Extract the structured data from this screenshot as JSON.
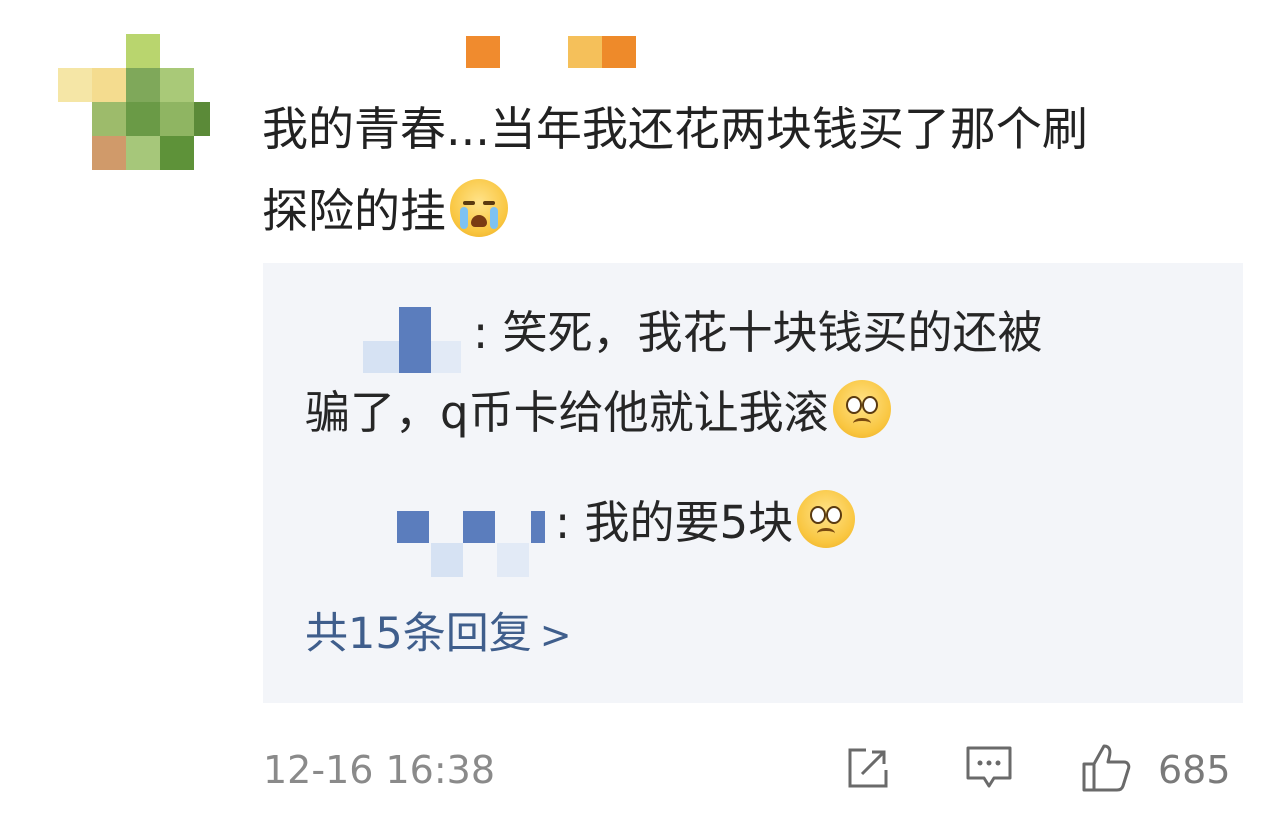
{
  "comment": {
    "line1": "我的青春...当年我还花两块钱买了那个刷",
    "line2": "探险的挂",
    "emoji": "loudly-crying-face-icon"
  },
  "replies": [
    {
      "text_line1": ": 笑死，我花十块钱买的还被",
      "text_line2": "骗了，q币卡给他就让我滚",
      "emoji": "pleading-face-icon"
    },
    {
      "text_line1": ": 我的要5块",
      "emoji": "pleading-face-icon"
    }
  ],
  "more_replies": {
    "label": "共15条回复",
    "chevron": ">"
  },
  "footer": {
    "timestamp": "12-16 16:38",
    "like_count": "685",
    "icons": [
      "share-icon",
      "comment-icon",
      "like-icon"
    ]
  },
  "colors": {
    "link": "#3f5e8c",
    "reply_bg": "#f3f5f9",
    "meta": "#8a8a8a"
  }
}
